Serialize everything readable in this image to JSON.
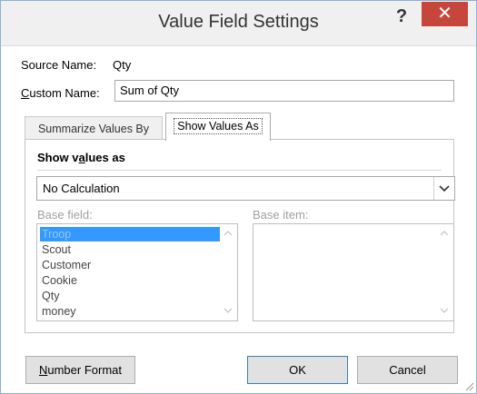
{
  "window": {
    "title": "Value Field Settings",
    "help_label": "?",
    "close_label": "✕"
  },
  "source": {
    "label": "Source Name:",
    "value": "Qty"
  },
  "custom_name": {
    "label_underlined": "C",
    "label_rest": "ustom Name:",
    "value": "Sum of Qty"
  },
  "tabs": [
    {
      "label": "Summarize Values By",
      "active": false
    },
    {
      "label": "Show Values As",
      "active": true
    }
  ],
  "show_values": {
    "heading_pre": "Show v",
    "heading_underlined": "a",
    "heading_post": "lues as",
    "selected": "No Calculation"
  },
  "base_field": {
    "label": "Base field:",
    "items": [
      "Troop",
      "Scout",
      "Customer",
      "Cookie",
      "Qty",
      "money"
    ],
    "selected_index": 0
  },
  "base_item": {
    "label": "Base item:",
    "items": []
  },
  "buttons": {
    "number_format_underlined": "N",
    "number_format_rest": "umber Format",
    "ok": "OK",
    "cancel": "Cancel"
  }
}
